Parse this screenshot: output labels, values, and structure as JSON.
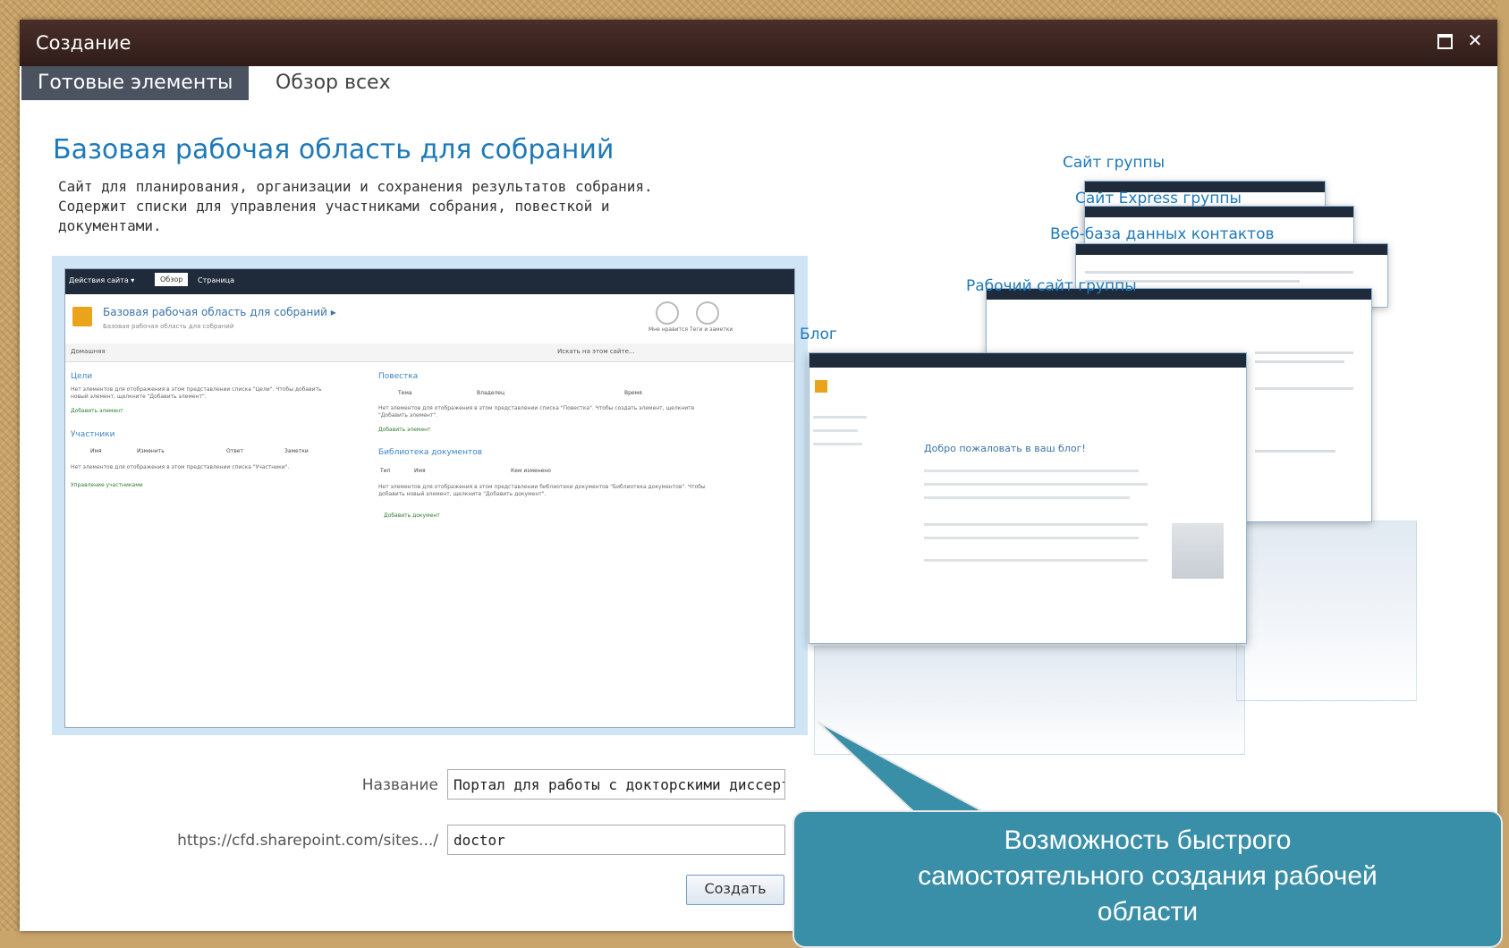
{
  "dialog": {
    "title": "Создание",
    "maximize_icon": "maximize-icon",
    "close_label": "✕"
  },
  "tabs": [
    {
      "label": "Готовые элементы",
      "active": true
    },
    {
      "label": "Обзор всех",
      "active": false
    }
  ],
  "template": {
    "title": "Базовая рабочая область для собраний",
    "description": "Сайт для планирования, организации и сохранения результатов собрания. Содержит списки для управления участниками собрания, повесткой и документами."
  },
  "preview": {
    "site_actions": "Действия сайта ▾",
    "tab_browse": "Обзор",
    "tab_page": "Страница",
    "site_title": "Базовая рабочая область для собраний ▸",
    "site_subtitle": "Базовая рабочая область для собраний",
    "like_label": "Мне нравится",
    "tags_label": "Теги и заметки",
    "nav_home": "Домашняя",
    "search_placeholder": "Искать на этом сайте...",
    "goals_heading": "Цели",
    "goals_empty": "Нет элементов для отображения в этом представлении списка \"Цели\". Чтобы добавить новый элемент, щелкните \"Добавить элемент\".",
    "add_item": "Добавить элемент",
    "participants_heading": "Участники",
    "participants_cols": [
      "Имя",
      "Изменить",
      "Ответ",
      "Заметки"
    ],
    "participants_empty": "Нет элементов для отображения в этом представлении списка \"Участники\".",
    "manage_participants": "Управление участниками",
    "agenda_heading": "Повестка",
    "agenda_cols": [
      "Тема",
      "Владелец",
      "Время"
    ],
    "agenda_empty": "Нет элементов для отображения в этом представлении списка \"Повестка\". Чтобы создать элемент, щелкните \"Добавить элемент\".",
    "doclib_heading": "Библиотека документов",
    "doclib_cols": [
      "Тип",
      "Имя",
      "Кем изменено"
    ],
    "doclib_empty": "Нет элементов для отображения в этом представлении библиотеки документов \"Библиотека документов\". Чтобы добавить новый элемент, щелкните \"Добавить документ\".",
    "add_document": "Добавить документ"
  },
  "gallery": {
    "labels": [
      "Сайт группы",
      "Сайт Express группы",
      "Веб-база данных контактов",
      "Рабочий сайт группы",
      "Блог"
    ],
    "blog_post_title": "Добро пожаловать в ваш блог!"
  },
  "form": {
    "name_label": "Название",
    "name_value": "Портал для работы с докторскими диссертациями",
    "url_label": "https://cfd.sharepoint.com/sites.../",
    "url_value": "doctor",
    "create_button": "Создать"
  },
  "callout": {
    "text_line1": "Возможность быстрого",
    "text_line2": "самостоятельного создания рабочей",
    "text_line3": "области",
    "color": "#3a8fa8"
  }
}
